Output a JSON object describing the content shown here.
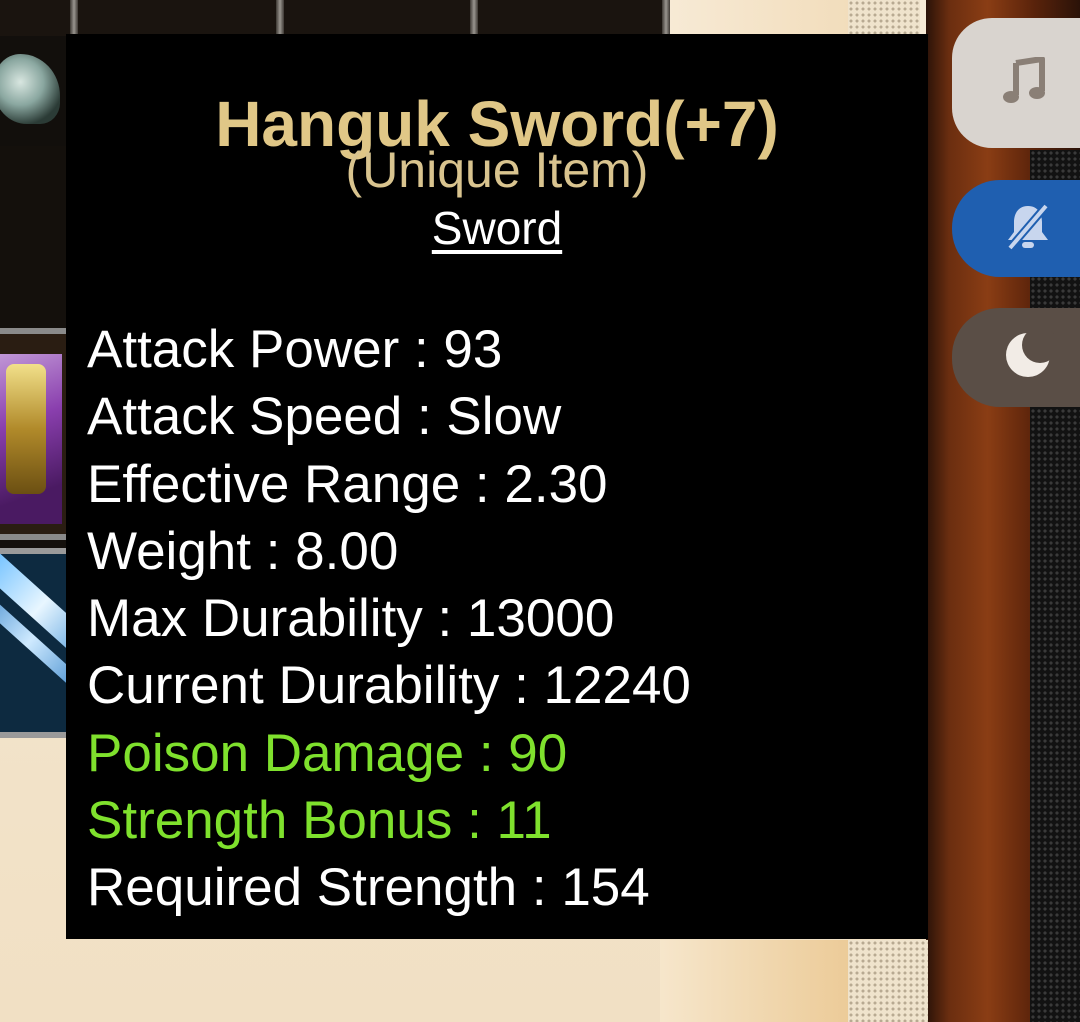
{
  "item": {
    "name": "Hanguk Sword(+7)",
    "rarity": "(Unique Item)",
    "type": "Sword"
  },
  "stats": [
    {
      "text": "Attack Power : 93",
      "kind": "base"
    },
    {
      "text": "Attack Speed : Slow",
      "kind": "base"
    },
    {
      "text": "Effective Range : 2.30",
      "kind": "base"
    },
    {
      "text": "Weight : 8.00",
      "kind": "base"
    },
    {
      "text": "Max Durability : 13000",
      "kind": "base"
    },
    {
      "text": "Current Durability : 12240",
      "kind": "base"
    },
    {
      "text": "Poison Damage : 90",
      "kind": "bonus"
    },
    {
      "text": "Strength Bonus : 11",
      "kind": "bonus"
    },
    {
      "text": "Required Strength : 154",
      "kind": "base"
    }
  ],
  "colors": {
    "title": "#e0c787",
    "base_stat": "#ffffff",
    "bonus_stat": "#7fe12d",
    "panel_bg": "#000000"
  },
  "controls": [
    {
      "name": "music",
      "icon": "music-note-icon"
    },
    {
      "name": "notifications-muted",
      "icon": "bell-off-icon"
    },
    {
      "name": "night-mode",
      "icon": "moon-icon"
    }
  ]
}
